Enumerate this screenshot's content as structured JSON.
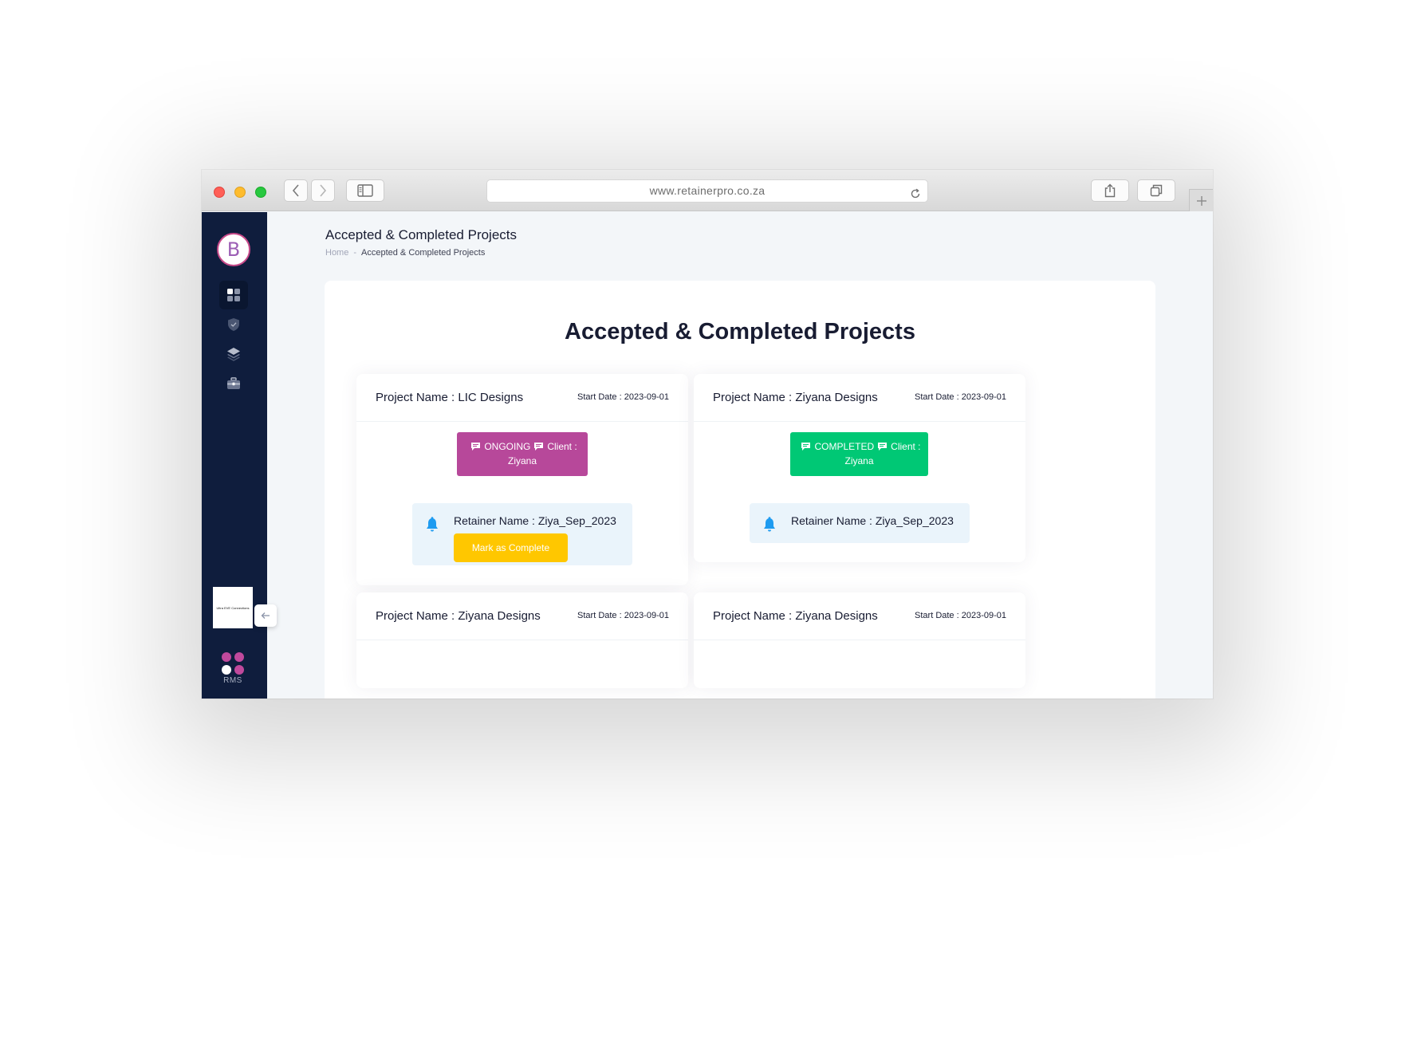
{
  "browser": {
    "url": "www.retainerpro.co.za"
  },
  "sidebar": {
    "logo_letter": "B",
    "nav_items": [
      {
        "icon": "dashboard-grid-icon",
        "active": true
      },
      {
        "icon": "shield-check-icon",
        "active": false
      },
      {
        "icon": "layers-icon",
        "active": false
      },
      {
        "icon": "briefcase-icon",
        "active": false
      }
    ],
    "partner_logo_text": "Ultra EVE Connections",
    "rms_label": "RMS",
    "rms_dot_colors": [
      "#c0499c",
      "#c0499c",
      "#ffffff",
      "#c0499c"
    ]
  },
  "header": {
    "title": "Accepted & Completed Projects",
    "breadcrumb_home": "Home",
    "breadcrumb_sep": "-",
    "breadcrumb_current": "Accepted & Completed Projects"
  },
  "main": {
    "title": "Accepted & Completed Projects",
    "projects": [
      {
        "name": "Project Name : LIC Designs",
        "start_date": "Start Date : 2023-09-01",
        "status": "ONGOING",
        "client_label": "Client :",
        "client_name": "Ziyana",
        "status_color": "#b7489a",
        "retainer": "Retainer Name : Ziya_Sep_2023",
        "action_label": "Mark as Complete"
      },
      {
        "name": "Project Name : Ziyana Designs",
        "start_date": "Start Date : 2023-09-01",
        "status": "COMPLETED",
        "client_label": "Client :",
        "client_name": "Ziyana",
        "status_color": "#00c875",
        "retainer": "Retainer Name : Ziya_Sep_2023"
      },
      {
        "name": "Project Name : Ziyana Designs",
        "start_date": "Start Date : 2023-09-01"
      },
      {
        "name": "Project Name : Ziyana Designs",
        "start_date": "Start Date : 2023-09-01"
      }
    ]
  },
  "colors": {
    "sidebar_bg": "#0f1d3d",
    "page_bg": "#f3f6f9",
    "accent_yellow": "#ffc700",
    "bell_blue": "#1e9bf0"
  }
}
